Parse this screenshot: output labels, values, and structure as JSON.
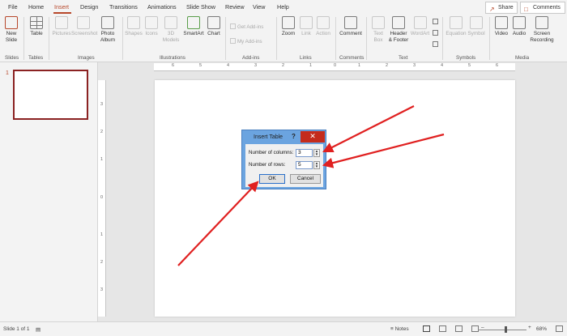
{
  "tabs": [
    "File",
    "Home",
    "Insert",
    "Design",
    "Transitions",
    "Animations",
    "Slide Show",
    "Review",
    "View",
    "Help"
  ],
  "active_tab": "Insert",
  "share_label": "Share",
  "comments_label": "Comments",
  "ribbon": {
    "new_slide": [
      "New",
      "Slide"
    ],
    "table": "Table",
    "pictures": "Pictures",
    "screenshot": "Screenshot",
    "photo_album": [
      "Photo",
      "Album"
    ],
    "shapes": "Shapes",
    "icons": "Icons",
    "models_3d": [
      "3D",
      "Models"
    ],
    "smartart": "SmartArt",
    "chart": "Chart",
    "get_addins": "Get Add-ins",
    "my_addins": "My Add-ins",
    "zoom": "Zoom",
    "link": "Link",
    "action": "Action",
    "comment": "Comment",
    "text_box": [
      "Text",
      "Box"
    ],
    "header_footer": [
      "Header",
      "& Footer"
    ],
    "wordart": "WordArt",
    "equation": "Equation",
    "symbol": "Symbol",
    "video": "Video",
    "audio": "Audio",
    "screen_recording": [
      "Screen",
      "Recording"
    ],
    "groups": [
      "Slides",
      "Tables",
      "Images",
      "Illustrations",
      "Add-ins",
      "Links",
      "Comments",
      "Text",
      "Symbols",
      "Media"
    ]
  },
  "thumbnail_number": "1",
  "ruler_numbers": [
    "6",
    "5",
    "4",
    "3",
    "2",
    "1",
    "0",
    "1",
    "2",
    "3",
    "4",
    "5",
    "6"
  ],
  "vruler_numbers": [
    "3",
    "2",
    "1",
    "0",
    "1",
    "2",
    "3"
  ],
  "dialog": {
    "title": "Insert Table",
    "help": "?",
    "close": "✕",
    "columns_label": "Number of columns:",
    "columns_value": "3",
    "rows_label": "Number of rows:",
    "rows_value": "5",
    "ok": "OK",
    "cancel": "Cancel"
  },
  "status": {
    "slide_info": "Slide 1 of 1",
    "notes": "Notes",
    "zoom": "68%"
  },
  "colors": {
    "accent": "#b7472a",
    "dialog_frame": "#6ba4e0",
    "close_red": "#c42b1c",
    "arrow": "#e02020"
  }
}
